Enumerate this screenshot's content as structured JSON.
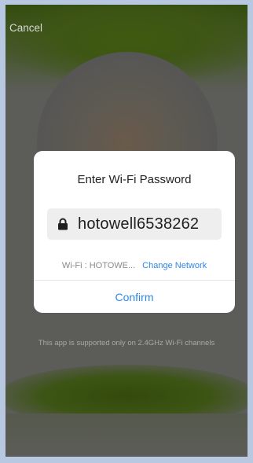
{
  "header": {
    "cancel_label": "Cancel"
  },
  "dialog": {
    "title": "Enter Wi-Fi Password",
    "password_value": "hotowell6538262",
    "wifi_label": "Wi-Fi : HOTOWE...",
    "change_network_label": "Change Network",
    "confirm_label": "Confirm"
  },
  "footer": {
    "note": "This app is supported only on 2.4GHz Wi-Fi channels"
  },
  "colors": {
    "accent": "#2f86e8",
    "overlay": "#5c5c58",
    "dialog_bg": "#ffffff"
  },
  "icons": {
    "password_field": "lock-icon"
  }
}
